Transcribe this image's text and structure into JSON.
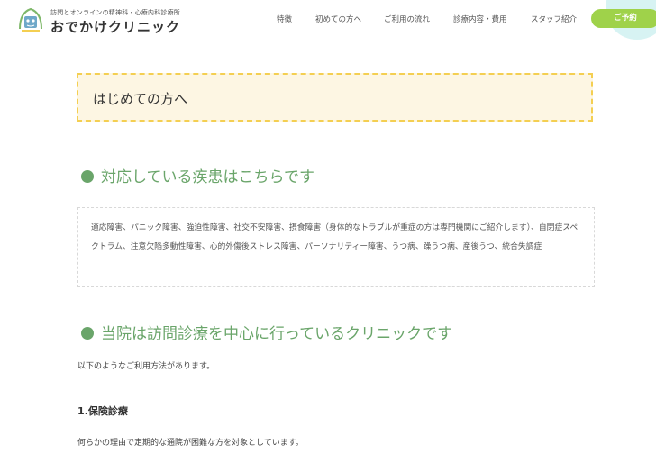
{
  "header": {
    "logo_subtitle": "訪問とオンラインの精神科・心療内科診療所",
    "logo_title": "おでかけクリニック",
    "nav": [
      "特徴",
      "初めての方へ",
      "ご利用の流れ",
      "診療内容・費用",
      "スタッフ紹介"
    ],
    "reserve_label": "ご予約"
  },
  "page_title": "はじめての方へ",
  "section1": {
    "heading": "対応している疾患はこちらです",
    "diseases": "適応障害、パニック障害、強迫性障害、社交不安障害、摂食障害（身体的なトラブルが重症の方は専門機関にご紹介します）、自閉症スペクトラム、注意欠陥多動性障害、心的外傷後ストレス障害、パーソナリティー障害、うつ病、躁うつ病、産後うつ、統合失調症"
  },
  "section2": {
    "heading": "当院は訪問診療を中心に行っているクリニックです",
    "intro": "以下のようなご利用方法があります。",
    "subheading": "1.保険診療",
    "text": "何らかの理由で定期的な通院が困難な方を対象としています。"
  },
  "colors": {
    "accent_green": "#6aa56a",
    "button_green": "#9fd24a",
    "title_box_bg": "#fdf6e3",
    "title_box_border": "#f4cf52"
  }
}
